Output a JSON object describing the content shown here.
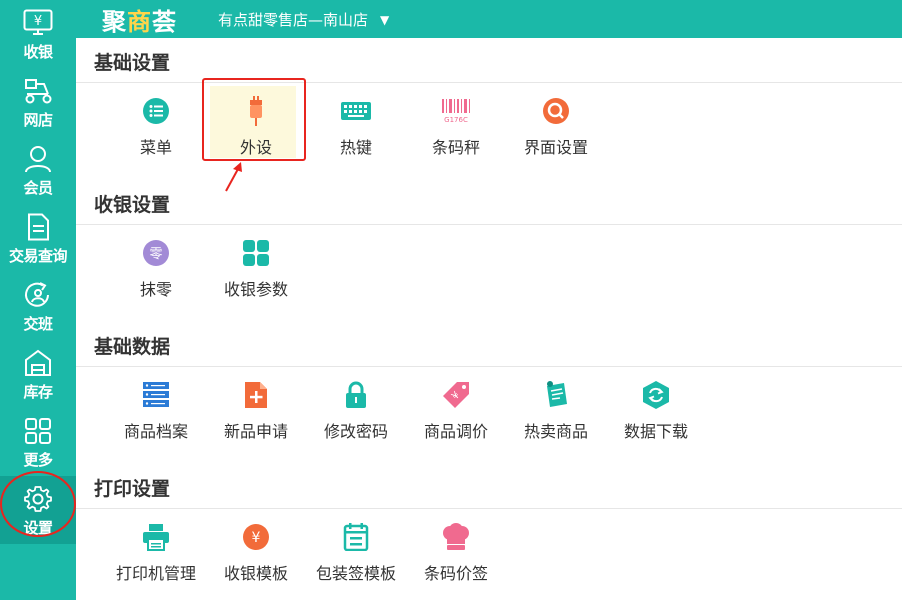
{
  "app": {
    "logo_main": "聚",
    "logo_accent": "商",
    "logo_end": "荟",
    "store_name": "有点甜零售店—南山店"
  },
  "sidebar": {
    "items": [
      {
        "label": "收银",
        "icon": "cashier-icon"
      },
      {
        "label": "网店",
        "icon": "delivery-scooter-icon"
      },
      {
        "label": "会员",
        "icon": "member-icon"
      },
      {
        "label": "交易查询",
        "icon": "document-icon"
      },
      {
        "label": "交班",
        "icon": "shift-handover-icon"
      },
      {
        "label": "库存",
        "icon": "warehouse-icon"
      },
      {
        "label": "更多",
        "icon": "grid-icon"
      },
      {
        "label": "设置",
        "icon": "gear-icon",
        "active": true
      }
    ]
  },
  "sections": [
    {
      "title": "基础设置",
      "items": [
        {
          "label": "菜单",
          "icon": "menu-list-icon"
        },
        {
          "label": "外设",
          "icon": "peripheral-plug-icon",
          "highlighted": true
        },
        {
          "label": "热键",
          "icon": "keyboard-icon"
        },
        {
          "label": "条码秤",
          "icon": "barcode-scale-icon",
          "icon_text": "G176C"
        },
        {
          "label": "界面设置",
          "icon": "interface-settings-icon"
        }
      ]
    },
    {
      "title": "收银设置",
      "items": [
        {
          "label": "抹零",
          "icon": "round-off-icon",
          "icon_text": "零"
        },
        {
          "label": "收银参数",
          "icon": "tiles-icon"
        }
      ]
    },
    {
      "title": "基础数据",
      "items": [
        {
          "label": "商品档案",
          "icon": "server-icon"
        },
        {
          "label": "新品申请",
          "icon": "new-file-icon"
        },
        {
          "label": "修改密码",
          "icon": "lock-icon"
        },
        {
          "label": "商品调价",
          "icon": "price-tag-icon"
        },
        {
          "label": "热卖商品",
          "icon": "hot-sale-note-icon"
        },
        {
          "label": "数据下载",
          "icon": "data-download-icon"
        }
      ]
    },
    {
      "title": "打印设置",
      "items": [
        {
          "label": "打印机管理",
          "icon": "printer-icon"
        },
        {
          "label": "收银模板",
          "icon": "yen-coin-icon",
          "icon_text": "¥"
        },
        {
          "label": "包装签模板",
          "icon": "package-label-icon"
        },
        {
          "label": "条码价签",
          "icon": "chef-hat-icon"
        }
      ]
    }
  ],
  "colors": {
    "brand": "#1bb9a8",
    "active_nav": "#12a193",
    "annotation": "#e8251f",
    "highlight": "#fdf9dc"
  }
}
